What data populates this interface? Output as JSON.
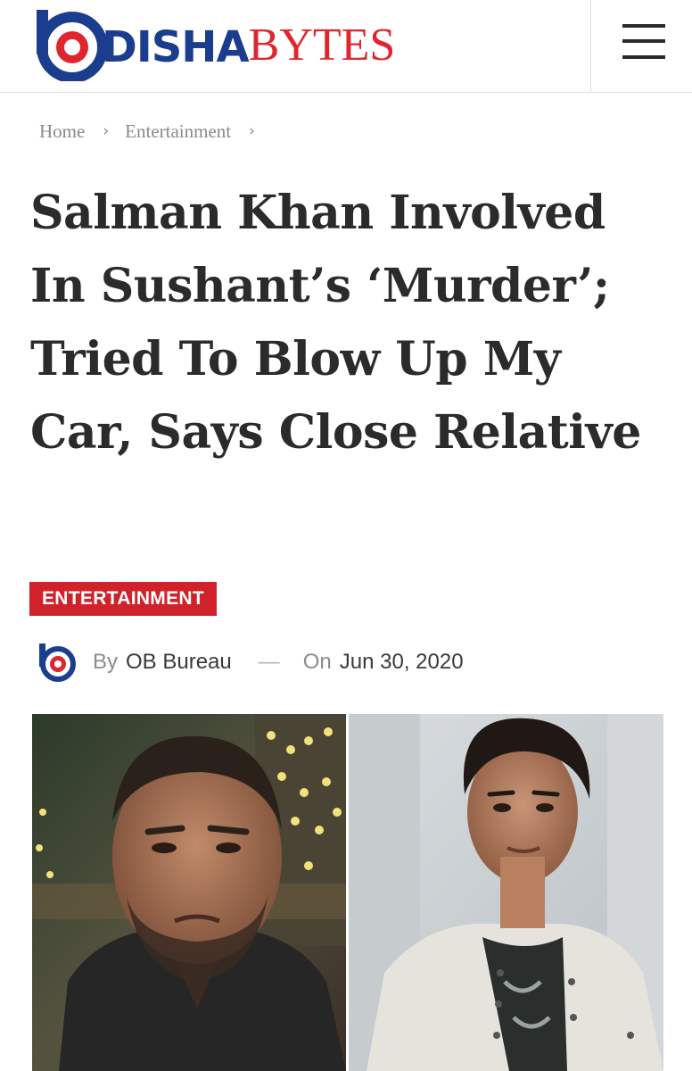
{
  "header": {
    "logo": {
      "part1": "DISHA",
      "part2": "BYTES",
      "brand_blue": "#1b3d8e",
      "brand_red": "#e0252e"
    },
    "menu_icon": "hamburger-menu-icon"
  },
  "breadcrumb": {
    "items": [
      "Home",
      "Entertainment"
    ],
    "separator": "›"
  },
  "article": {
    "headline": "Salman Khan Involved In Sushant’s ‘Murder’; Tried To Blow Up My Car, Says Close Relative",
    "category": "ENTERTAINMENT",
    "category_color": "#d1212a",
    "meta": {
      "by_label": "By",
      "author": "OB Bureau",
      "separator": "—",
      "on_label": "On",
      "date": "Jun 30, 2020"
    },
    "images": [
      {
        "icon": "photo-salman-khan"
      },
      {
        "icon": "photo-sushant-singh-rajput"
      }
    ]
  }
}
